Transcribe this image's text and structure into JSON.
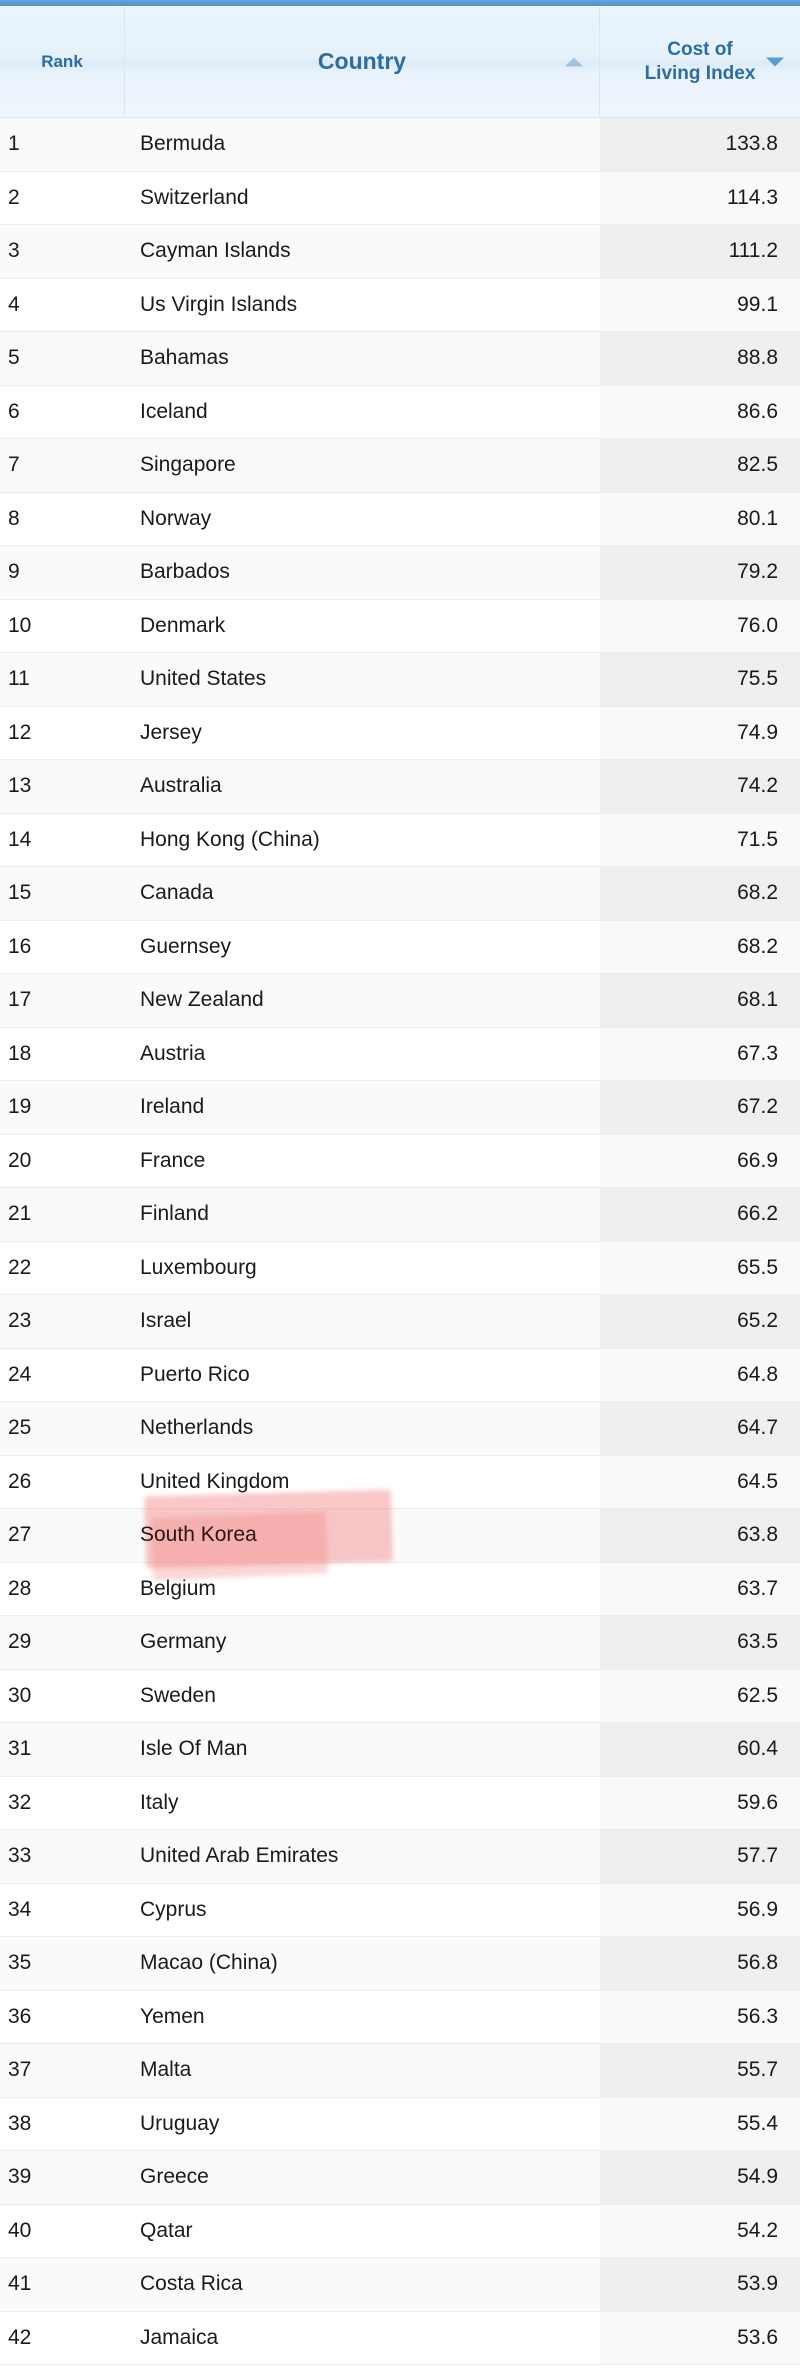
{
  "table": {
    "columns": [
      {
        "key": "rank",
        "label": "Rank",
        "sort": "none",
        "align": "left"
      },
      {
        "key": "country",
        "label": "Country",
        "sort": "ascending",
        "align": "left",
        "sort_icon": "chevron-up-icon"
      },
      {
        "key": "value",
        "label": "Cost of Living Index",
        "sort": "descending",
        "align": "right",
        "sort_icon": "chevron-down-icon"
      }
    ],
    "highlighted_country": "South Korea",
    "highlight_color": "#f37c7c",
    "accent_color": "#5b9bd5",
    "header_text_color": "#2b6ca3",
    "rows": [
      {
        "rank": "1",
        "country": "Bermuda",
        "value": "133.8"
      },
      {
        "rank": "2",
        "country": "Switzerland",
        "value": "114.3"
      },
      {
        "rank": "3",
        "country": "Cayman Islands",
        "value": "111.2"
      },
      {
        "rank": "4",
        "country": "Us Virgin Islands",
        "value": "99.1"
      },
      {
        "rank": "5",
        "country": "Bahamas",
        "value": "88.8"
      },
      {
        "rank": "6",
        "country": "Iceland",
        "value": "86.6"
      },
      {
        "rank": "7",
        "country": "Singapore",
        "value": "82.5"
      },
      {
        "rank": "8",
        "country": "Norway",
        "value": "80.1"
      },
      {
        "rank": "9",
        "country": "Barbados",
        "value": "79.2"
      },
      {
        "rank": "10",
        "country": "Denmark",
        "value": "76.0"
      },
      {
        "rank": "11",
        "country": "United States",
        "value": "75.5"
      },
      {
        "rank": "12",
        "country": "Jersey",
        "value": "74.9"
      },
      {
        "rank": "13",
        "country": "Australia",
        "value": "74.2"
      },
      {
        "rank": "14",
        "country": "Hong Kong (China)",
        "value": "71.5"
      },
      {
        "rank": "15",
        "country": "Canada",
        "value": "68.2"
      },
      {
        "rank": "16",
        "country": "Guernsey",
        "value": "68.2"
      },
      {
        "rank": "17",
        "country": "New Zealand",
        "value": "68.1"
      },
      {
        "rank": "18",
        "country": "Austria",
        "value": "67.3"
      },
      {
        "rank": "19",
        "country": "Ireland",
        "value": "67.2"
      },
      {
        "rank": "20",
        "country": "France",
        "value": "66.9"
      },
      {
        "rank": "21",
        "country": "Finland",
        "value": "66.2"
      },
      {
        "rank": "22",
        "country": "Luxembourg",
        "value": "65.5"
      },
      {
        "rank": "23",
        "country": "Israel",
        "value": "65.2"
      },
      {
        "rank": "24",
        "country": "Puerto Rico",
        "value": "64.8"
      },
      {
        "rank": "25",
        "country": "Netherlands",
        "value": "64.7"
      },
      {
        "rank": "26",
        "country": "United Kingdom",
        "value": "64.5"
      },
      {
        "rank": "27",
        "country": "South Korea",
        "value": "63.8"
      },
      {
        "rank": "28",
        "country": "Belgium",
        "value": "63.7"
      },
      {
        "rank": "29",
        "country": "Germany",
        "value": "63.5"
      },
      {
        "rank": "30",
        "country": "Sweden",
        "value": "62.5"
      },
      {
        "rank": "31",
        "country": "Isle Of Man",
        "value": "60.4"
      },
      {
        "rank": "32",
        "country": "Italy",
        "value": "59.6"
      },
      {
        "rank": "33",
        "country": "United Arab Emirates",
        "value": "57.7"
      },
      {
        "rank": "34",
        "country": "Cyprus",
        "value": "56.9"
      },
      {
        "rank": "35",
        "country": "Macao (China)",
        "value": "56.8"
      },
      {
        "rank": "36",
        "country": "Yemen",
        "value": "56.3"
      },
      {
        "rank": "37",
        "country": "Malta",
        "value": "55.7"
      },
      {
        "rank": "38",
        "country": "Uruguay",
        "value": "55.4"
      },
      {
        "rank": "39",
        "country": "Greece",
        "value": "54.9"
      },
      {
        "rank": "40",
        "country": "Qatar",
        "value": "54.2"
      },
      {
        "rank": "41",
        "country": "Costa Rica",
        "value": "53.9"
      },
      {
        "rank": "42",
        "country": "Jamaica",
        "value": "53.6"
      }
    ]
  }
}
